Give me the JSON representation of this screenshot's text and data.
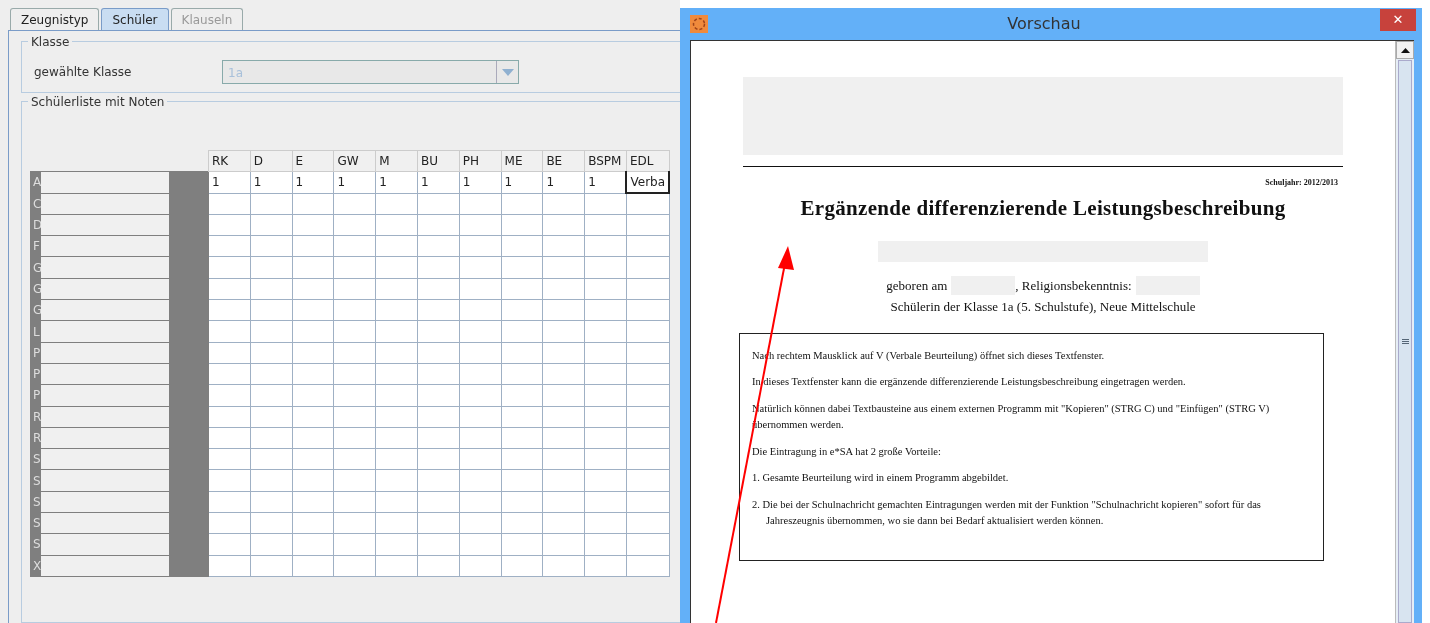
{
  "tabs": [
    {
      "label": "Zeugnistyp",
      "selected": false,
      "disabled": false
    },
    {
      "label": "Schüler",
      "selected": true,
      "disabled": false
    },
    {
      "label": "Klauseln",
      "selected": false,
      "disabled": true
    }
  ],
  "klasse": {
    "legend": "Klasse",
    "label": "gewählte Klasse",
    "value": "1a",
    "disabled": true
  },
  "schuelerliste": {
    "legend": "Schülerliste mit Noten",
    "columns": [
      "RK",
      "D",
      "E",
      "GW",
      "M",
      "BU",
      "PH",
      "ME",
      "BE",
      "BSPM",
      "EDL"
    ],
    "rows": [
      {
        "name": "A",
        "grades": [
          "1",
          "1",
          "1",
          "1",
          "1",
          "1",
          "1",
          "1",
          "1",
          "1",
          "Verba"
        ]
      },
      {
        "name": "C"
      },
      {
        "name": "D"
      },
      {
        "name": "F"
      },
      {
        "name": "G"
      },
      {
        "name": "G"
      },
      {
        "name": "G"
      },
      {
        "name": "L"
      },
      {
        "name": "P"
      },
      {
        "name": "P"
      },
      {
        "name": "P"
      },
      {
        "name": "R"
      },
      {
        "name": "R"
      },
      {
        "name": "S"
      },
      {
        "name": "S"
      },
      {
        "name": "S"
      },
      {
        "name": "S"
      },
      {
        "name": "S"
      },
      {
        "name": "X"
      }
    ]
  },
  "preview": {
    "title": "Vorschau",
    "close": "✕",
    "school_year": "Schuljahr: 2012/2013",
    "heading": "Ergänzende differenzierende Leistungsbeschreibung",
    "born_label": "geboren am",
    "religion_label": ", Religionsbekenntnis:",
    "class_line": "Schülerin der Klasse 1a (5. Schulstufe), Neue Mittelschule",
    "paragraphs": [
      "Nach rechtem Mausklick auf V (Verbale Beurteilung) öffnet sich dieses Textfenster.",
      "In dieses Textfenster kann die ergänzende differenzierende Leistungsbeschreibung eingetragen werden.",
      "Natürlich können dabei Textbausteine aus einem externen Programm mit \"Kopieren\" (STRG C) und \"Einfügen\" (STRG V) übernommen werden.",
      "Die Eintragung in e*SA hat 2 große Vorteile:"
    ],
    "list": [
      "1. Gesamte Beurteilung wird in einem Programm abgebildet.",
      "2. Die bei der Schulnachricht gemachten Eintragungen werden mit der Funktion \"Schulnachricht kopieren\" sofort für das Jahreszeugnis übernommen, wo sie dann bei Bedarf aktualisiert werden können."
    ]
  }
}
